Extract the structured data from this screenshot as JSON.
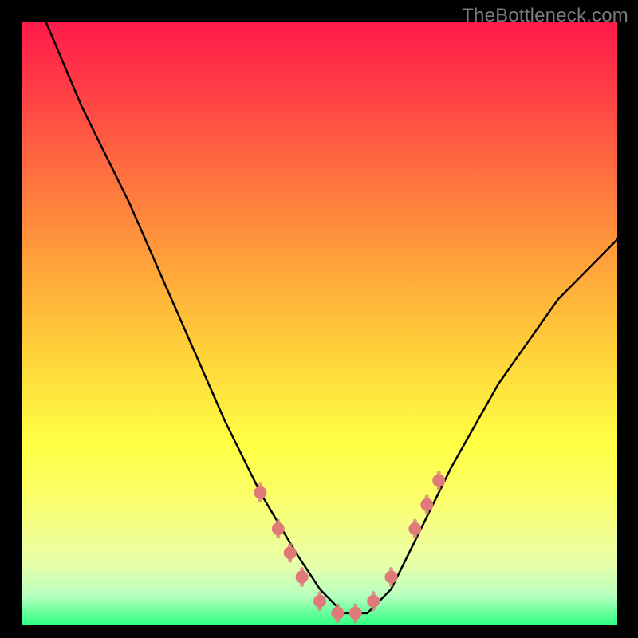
{
  "watermark": "TheBottleneck.com",
  "chart_data": {
    "type": "line",
    "title": "",
    "xlabel": "",
    "ylabel": "",
    "xlim": [
      0,
      100
    ],
    "ylim": [
      0,
      100
    ],
    "series": [
      {
        "name": "bottleneck-curve",
        "x": [
          4,
          10,
          18,
          26,
          34,
          40,
          46,
          50,
          54,
          58,
          62,
          66,
          72,
          80,
          90,
          100
        ],
        "y": [
          100,
          86,
          70,
          52,
          34,
          22,
          12,
          6,
          2,
          2,
          6,
          14,
          26,
          40,
          54,
          64
        ]
      }
    ],
    "markers": {
      "name": "highlighted-points",
      "color": "#e07a7a",
      "points": [
        {
          "x": 40,
          "y": 22
        },
        {
          "x": 43,
          "y": 16
        },
        {
          "x": 45,
          "y": 12
        },
        {
          "x": 47,
          "y": 8
        },
        {
          "x": 50,
          "y": 4
        },
        {
          "x": 53,
          "y": 2
        },
        {
          "x": 56,
          "y": 2
        },
        {
          "x": 59,
          "y": 4
        },
        {
          "x": 62,
          "y": 8
        },
        {
          "x": 66,
          "y": 16
        },
        {
          "x": 68,
          "y": 20
        },
        {
          "x": 70,
          "y": 24
        }
      ]
    }
  }
}
